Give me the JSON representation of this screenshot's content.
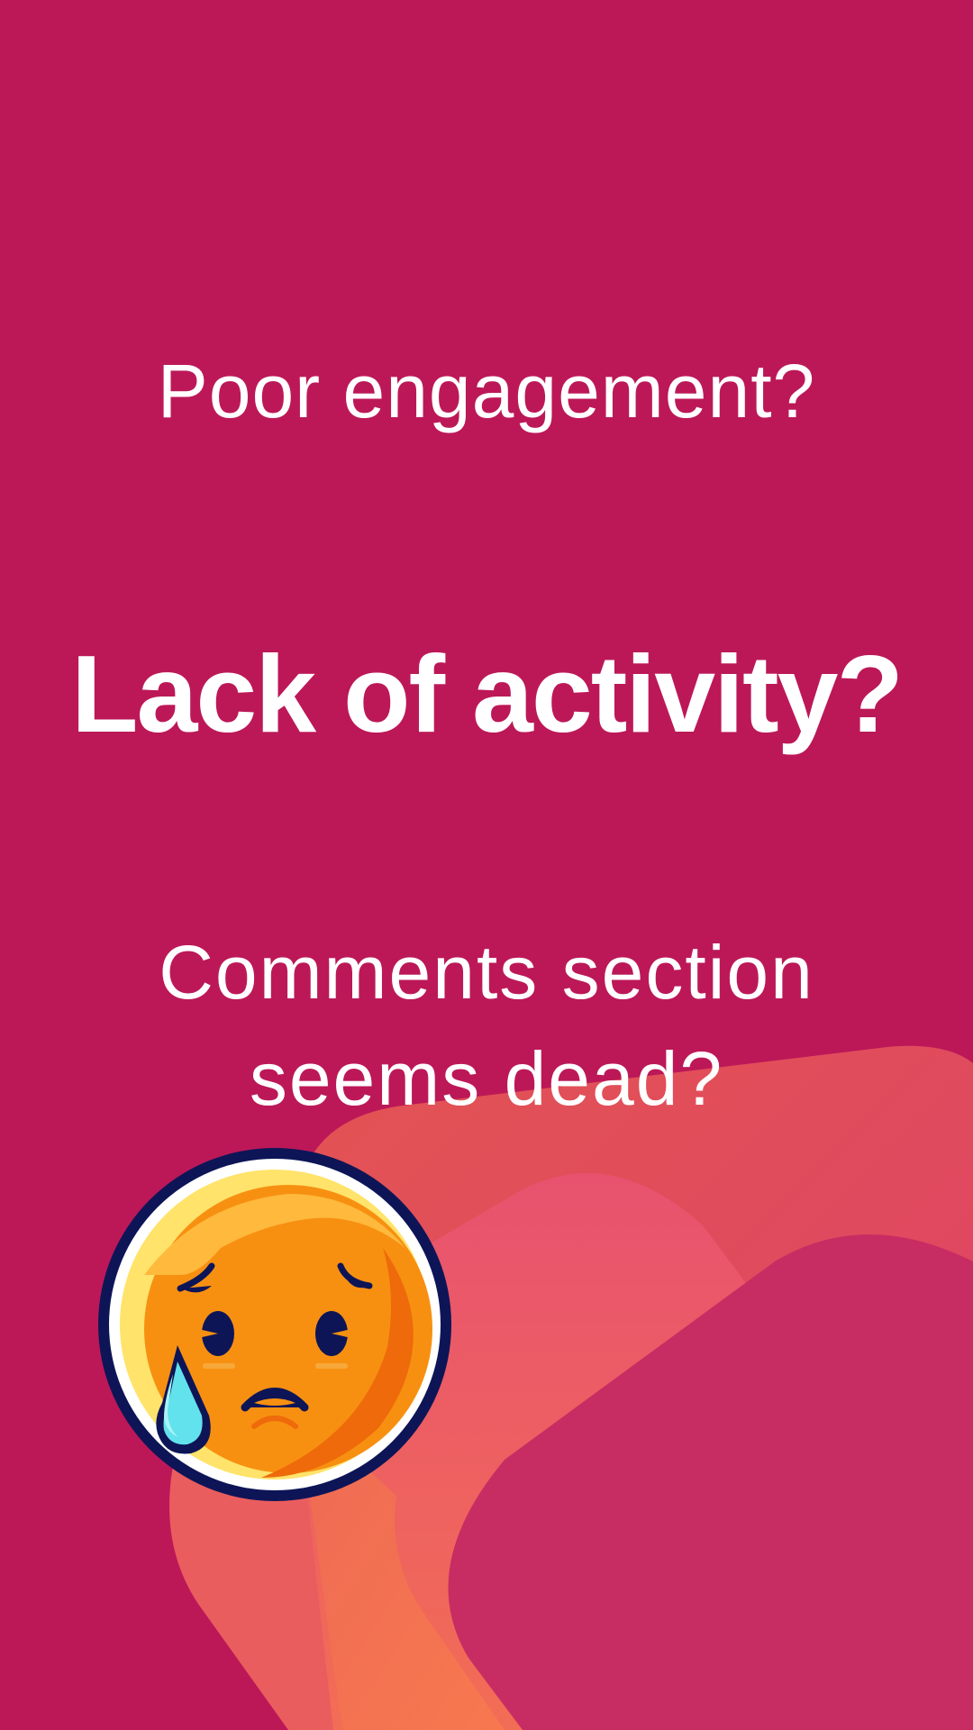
{
  "colors": {
    "background": "#BC1858",
    "text": "#FFFFFF",
    "shape_coral": "#EA5D5E",
    "shape_pink": "#E9586F",
    "shape_magenta": "#C72D63",
    "emoji_face": "#F7900E",
    "emoji_outline": "#0D1557",
    "emoji_tear": "#62E2EC"
  },
  "headlines": {
    "line1": "Poor engagement?",
    "line2": "Lack of activity?",
    "line3a": "Comments section",
    "line3b": "seems dead?"
  },
  "illustration": {
    "emoji": "sad-face-with-sweat-drop-icon",
    "background": "abstract-rounded-shapes"
  }
}
